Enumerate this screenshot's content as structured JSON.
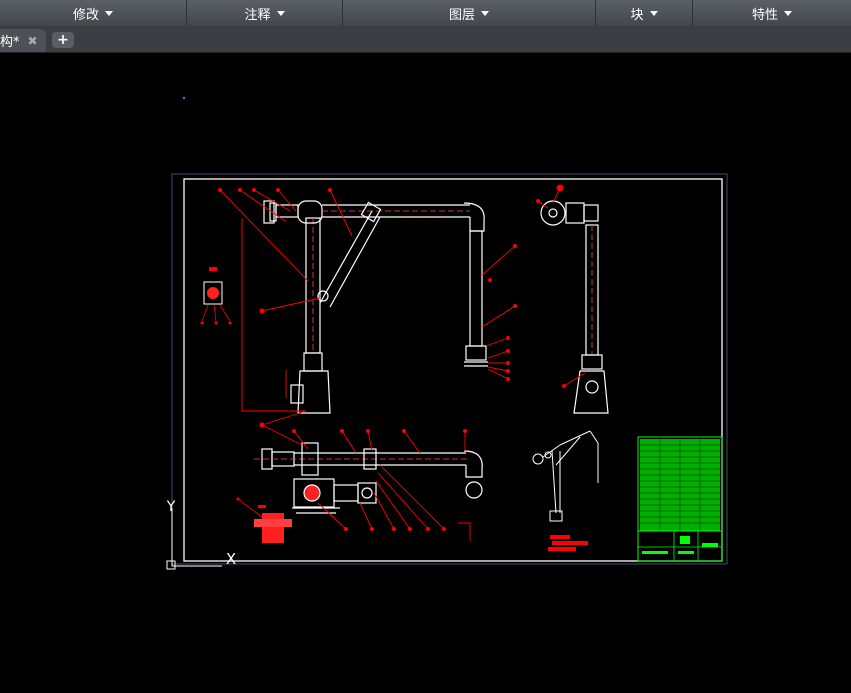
{
  "menu": {
    "items": [
      {
        "label": "修改"
      },
      {
        "label": "注释"
      },
      {
        "label": "图层"
      },
      {
        "label": "块"
      },
      {
        "label": "特性"
      }
    ]
  },
  "tabs": {
    "active_label": "构*",
    "close_glyph": "✖",
    "new_tab_glyph": "+"
  },
  "ucs": {
    "y_label": "Y",
    "x_label": "X"
  },
  "colors": {
    "drawing_frame": "#ffffff",
    "annotation": "#ff0000",
    "title_block": "#00ff00",
    "ucs_icon": "#ffffff"
  }
}
